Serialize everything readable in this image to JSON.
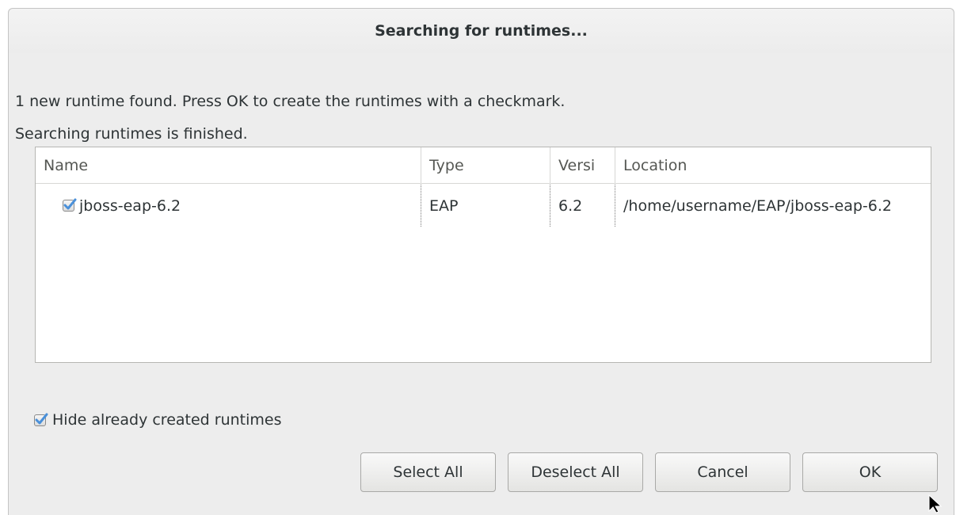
{
  "dialog": {
    "title": "Searching for runtimes...",
    "message": "1 new runtime found. Press OK to create the runtimes with a checkmark.",
    "status": "Searching runtimes is finished."
  },
  "table": {
    "columns": [
      "Name",
      "Type",
      "Versi",
      "Location"
    ],
    "rows": [
      {
        "checked": true,
        "name": "jboss-eap-6.2",
        "type": "EAP",
        "version": "6.2",
        "location": "/home/username/EAP/jboss-eap-6.2"
      }
    ]
  },
  "options": {
    "hide_created_label": "Hide already created runtimes",
    "hide_created_checked": true
  },
  "buttons": {
    "select_all": "Select All",
    "deselect_all": "Deselect All",
    "cancel": "Cancel",
    "ok": "OK"
  },
  "colors": {
    "dialog_bg": "#ededed",
    "checkmark": "#4a90d9"
  }
}
